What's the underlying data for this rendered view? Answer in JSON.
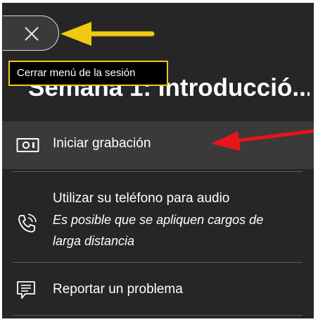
{
  "tooltip": {
    "text": "Cerrar menú de la sesión"
  },
  "session": {
    "title": "Semana 1: Introducció..."
  },
  "menu": {
    "record_label": "Iniciar grabación",
    "phone_label": "Utilizar su teléfono para audio",
    "phone_note": "Es posible que se apliquen cargos de larga distancia",
    "report_label": "Reportar un problema"
  },
  "icons": {
    "close": "close-icon",
    "record": "video-camera-icon",
    "phone": "phone-icon",
    "report": "report-message-icon"
  },
  "annotations": {
    "yellow_arrow_color": "#f2c811",
    "red_arrow_color": "#e8141b"
  },
  "colors": {
    "panel_bg": "#262626",
    "highlight_bg": "#3a3a3a",
    "tooltip_border": "#f2c811"
  }
}
